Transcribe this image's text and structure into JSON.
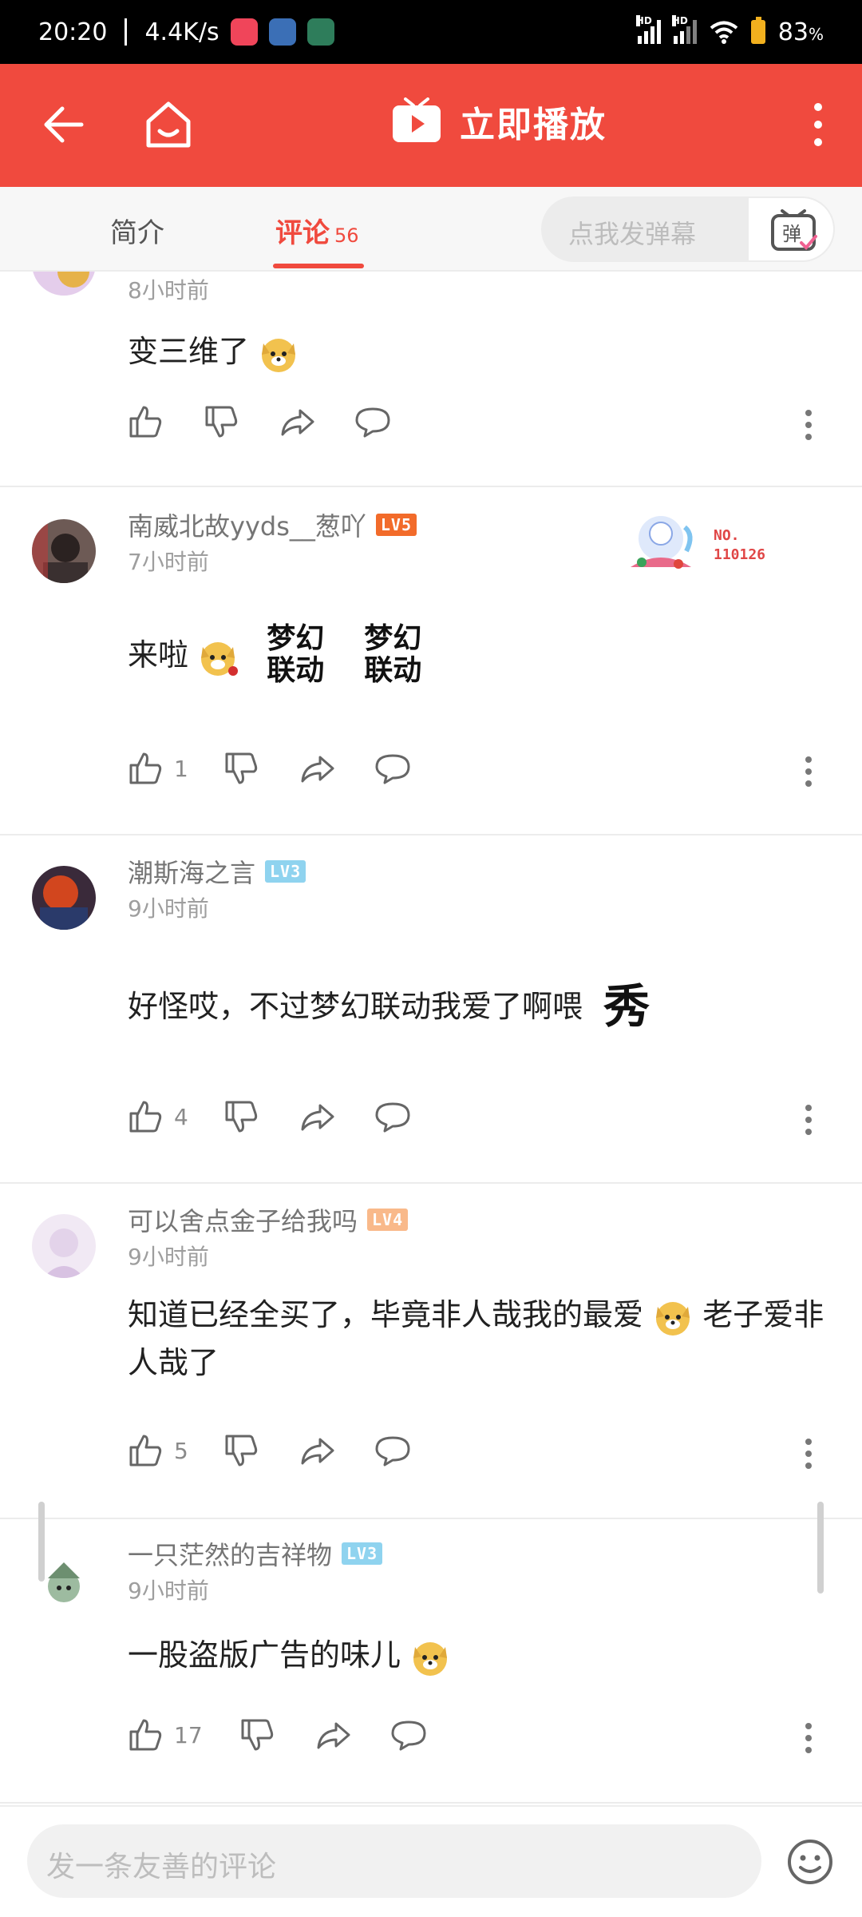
{
  "status": {
    "time": "20:20",
    "speed": "4.4K/s",
    "battery": "83"
  },
  "header": {
    "title": "立即播放"
  },
  "tabs": {
    "intro": "简介",
    "comments": "评论",
    "comments_count": "56",
    "danmaku_placeholder": "点我发弹幕",
    "danmaku_button": "弹"
  },
  "comments": [
    {
      "time": "8小时前",
      "text": "变三维了",
      "like_count": ""
    },
    {
      "username": "南威北故yyds__葱吖",
      "level": "LV5",
      "time": "7小时前",
      "text": "来啦",
      "sticker": "梦幻联动",
      "like_count": "1",
      "badge": "NO. 110126"
    },
    {
      "username": "潮斯海之言",
      "level": "LV3",
      "time": "9小时前",
      "text": "好怪哎，不过梦幻联动我爱了啊喂",
      "sticker": "秀",
      "like_count": "4"
    },
    {
      "username": "可以舍点金子给我吗",
      "level": "LV4",
      "time": "9小时前",
      "text_part1": "知道已经全买了，毕竟非人哉我的最爱",
      "text_part2": "老子爱非人哉了",
      "like_count": "5"
    },
    {
      "username": "一只茫然的吉祥物",
      "level": "LV3",
      "time": "9小时前",
      "text": "一股盗版广告的味儿",
      "like_count": "17"
    }
  ],
  "input": {
    "placeholder": "发一条友善的评论"
  },
  "colors": {
    "brand": "#f04a3e",
    "lv5": "#f26b2a",
    "lv4": "#f9b98a",
    "lv3": "#8fd3ef"
  }
}
